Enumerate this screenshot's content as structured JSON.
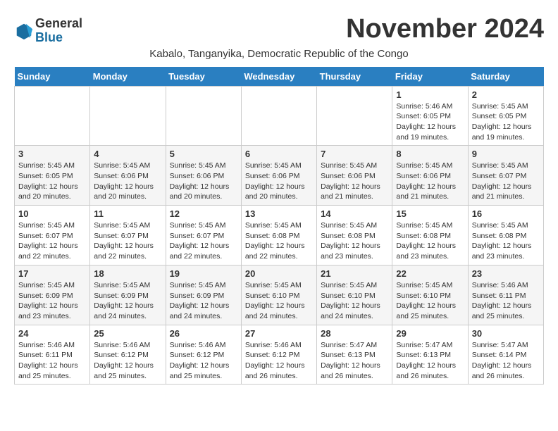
{
  "logo": {
    "general": "General",
    "blue": "Blue"
  },
  "title": "November 2024",
  "subtitle": "Kabalo, Tanganyika, Democratic Republic of the Congo",
  "days_of_week": [
    "Sunday",
    "Monday",
    "Tuesday",
    "Wednesday",
    "Thursday",
    "Friday",
    "Saturday"
  ],
  "weeks": [
    [
      {
        "day": "",
        "info": ""
      },
      {
        "day": "",
        "info": ""
      },
      {
        "day": "",
        "info": ""
      },
      {
        "day": "",
        "info": ""
      },
      {
        "day": "",
        "info": ""
      },
      {
        "day": "1",
        "info": "Sunrise: 5:46 AM\nSunset: 6:05 PM\nDaylight: 12 hours\nand 19 minutes."
      },
      {
        "day": "2",
        "info": "Sunrise: 5:45 AM\nSunset: 6:05 PM\nDaylight: 12 hours\nand 19 minutes."
      }
    ],
    [
      {
        "day": "3",
        "info": "Sunrise: 5:45 AM\nSunset: 6:05 PM\nDaylight: 12 hours\nand 20 minutes."
      },
      {
        "day": "4",
        "info": "Sunrise: 5:45 AM\nSunset: 6:06 PM\nDaylight: 12 hours\nand 20 minutes."
      },
      {
        "day": "5",
        "info": "Sunrise: 5:45 AM\nSunset: 6:06 PM\nDaylight: 12 hours\nand 20 minutes."
      },
      {
        "day": "6",
        "info": "Sunrise: 5:45 AM\nSunset: 6:06 PM\nDaylight: 12 hours\nand 20 minutes."
      },
      {
        "day": "7",
        "info": "Sunrise: 5:45 AM\nSunset: 6:06 PM\nDaylight: 12 hours\nand 21 minutes."
      },
      {
        "day": "8",
        "info": "Sunrise: 5:45 AM\nSunset: 6:06 PM\nDaylight: 12 hours\nand 21 minutes."
      },
      {
        "day": "9",
        "info": "Sunrise: 5:45 AM\nSunset: 6:07 PM\nDaylight: 12 hours\nand 21 minutes."
      }
    ],
    [
      {
        "day": "10",
        "info": "Sunrise: 5:45 AM\nSunset: 6:07 PM\nDaylight: 12 hours\nand 22 minutes."
      },
      {
        "day": "11",
        "info": "Sunrise: 5:45 AM\nSunset: 6:07 PM\nDaylight: 12 hours\nand 22 minutes."
      },
      {
        "day": "12",
        "info": "Sunrise: 5:45 AM\nSunset: 6:07 PM\nDaylight: 12 hours\nand 22 minutes."
      },
      {
        "day": "13",
        "info": "Sunrise: 5:45 AM\nSunset: 6:08 PM\nDaylight: 12 hours\nand 22 minutes."
      },
      {
        "day": "14",
        "info": "Sunrise: 5:45 AM\nSunset: 6:08 PM\nDaylight: 12 hours\nand 23 minutes."
      },
      {
        "day": "15",
        "info": "Sunrise: 5:45 AM\nSunset: 6:08 PM\nDaylight: 12 hours\nand 23 minutes."
      },
      {
        "day": "16",
        "info": "Sunrise: 5:45 AM\nSunset: 6:08 PM\nDaylight: 12 hours\nand 23 minutes."
      }
    ],
    [
      {
        "day": "17",
        "info": "Sunrise: 5:45 AM\nSunset: 6:09 PM\nDaylight: 12 hours\nand 23 minutes."
      },
      {
        "day": "18",
        "info": "Sunrise: 5:45 AM\nSunset: 6:09 PM\nDaylight: 12 hours\nand 24 minutes."
      },
      {
        "day": "19",
        "info": "Sunrise: 5:45 AM\nSunset: 6:09 PM\nDaylight: 12 hours\nand 24 minutes."
      },
      {
        "day": "20",
        "info": "Sunrise: 5:45 AM\nSunset: 6:10 PM\nDaylight: 12 hours\nand 24 minutes."
      },
      {
        "day": "21",
        "info": "Sunrise: 5:45 AM\nSunset: 6:10 PM\nDaylight: 12 hours\nand 24 minutes."
      },
      {
        "day": "22",
        "info": "Sunrise: 5:45 AM\nSunset: 6:10 PM\nDaylight: 12 hours\nand 25 minutes."
      },
      {
        "day": "23",
        "info": "Sunrise: 5:46 AM\nSunset: 6:11 PM\nDaylight: 12 hours\nand 25 minutes."
      }
    ],
    [
      {
        "day": "24",
        "info": "Sunrise: 5:46 AM\nSunset: 6:11 PM\nDaylight: 12 hours\nand 25 minutes."
      },
      {
        "day": "25",
        "info": "Sunrise: 5:46 AM\nSunset: 6:12 PM\nDaylight: 12 hours\nand 25 minutes."
      },
      {
        "day": "26",
        "info": "Sunrise: 5:46 AM\nSunset: 6:12 PM\nDaylight: 12 hours\nand 25 minutes."
      },
      {
        "day": "27",
        "info": "Sunrise: 5:46 AM\nSunset: 6:12 PM\nDaylight: 12 hours\nand 26 minutes."
      },
      {
        "day": "28",
        "info": "Sunrise: 5:47 AM\nSunset: 6:13 PM\nDaylight: 12 hours\nand 26 minutes."
      },
      {
        "day": "29",
        "info": "Sunrise: 5:47 AM\nSunset: 6:13 PM\nDaylight: 12 hours\nand 26 minutes."
      },
      {
        "day": "30",
        "info": "Sunrise: 5:47 AM\nSunset: 6:14 PM\nDaylight: 12 hours\nand 26 minutes."
      }
    ]
  ]
}
